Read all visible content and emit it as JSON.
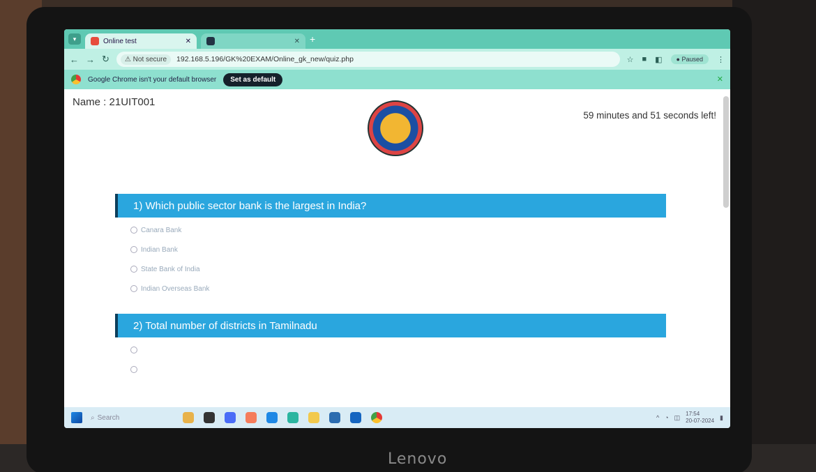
{
  "browser": {
    "tabs": [
      {
        "title": "Online test",
        "active": true
      },
      {
        "title": "",
        "active": false
      }
    ],
    "security_label": "Not secure",
    "url": "192.168.5.196/GK%20EXAM/Online_gk_new/quiz.php",
    "profile_label": "Paused"
  },
  "infobar": {
    "message": "Google Chrome isn't your default browser",
    "button": "Set as default"
  },
  "page": {
    "name_label": "Name : 21UIT001",
    "timer": "59 minutes and 51 seconds left!"
  },
  "questions": [
    {
      "title": "1) Which public sector bank is the largest in India?",
      "options": [
        "Canara Bank",
        "Indian Bank",
        "State Bank of India",
        "Indian Overseas Bank"
      ]
    },
    {
      "title": "2)  Total number of districts in Tamilnadu",
      "options": [
        "",
        ""
      ]
    }
  ],
  "taskbar": {
    "search_label": "Search",
    "clock_time": "17:54",
    "clock_date": "20-07-2024"
  },
  "monitor": {
    "brand": "Lenovo"
  },
  "colors": {
    "question_header": "#2aa6de",
    "chrome_theme": "#5fc9b3"
  }
}
